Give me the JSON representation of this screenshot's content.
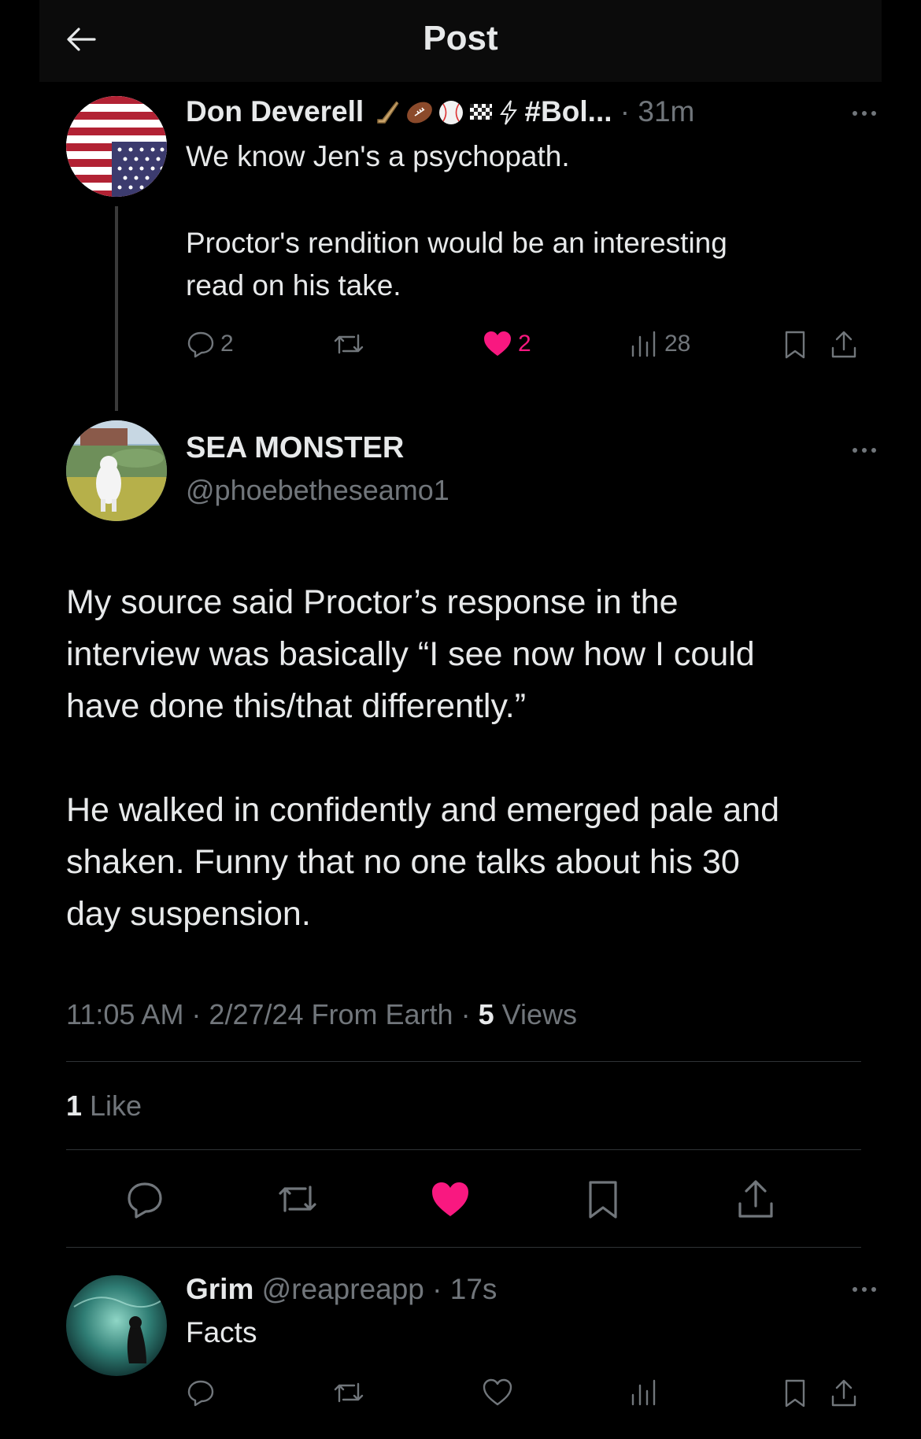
{
  "header": {
    "title": "Post",
    "back_icon": "arrow-left-icon"
  },
  "parent_post": {
    "author": "Don Deverell",
    "badge_emojis": [
      "hockey-stick-icon",
      "football-icon",
      "baseball-icon",
      "checkered-flag-icon",
      "lightning-icon"
    ],
    "hashtag": "#Bol...",
    "time": "· 31m",
    "text_line1": "We know Jen's a psychopath.",
    "text_line2": "Proctor's rendition would be an interesting",
    "text_line3": "read on his take.",
    "replies": "2",
    "reposts": "",
    "likes": "2",
    "views": "28",
    "liked": true
  },
  "main_post": {
    "author": "SEA MONSTER",
    "handle": "@phoebetheseamo1",
    "lines": [
      "My source said Proctor’s response in the",
      "interview was basically “I see now how I could",
      "have done this/that differently.”",
      " He walked in confidently and emerged pale and",
      "shaken. Funny that no one talks about his 30",
      "day suspension."
    ],
    "meta_time": "11:05 AM · 2/27/24 From Earth · ",
    "meta_views_count": "5",
    "meta_views_label": " Views",
    "likes_count": "1",
    "likes_label": " Like",
    "liked": true
  },
  "reply": {
    "author": "Grim",
    "handle": "@reapreapp",
    "time": "· 17s",
    "text": "Facts"
  },
  "colors": {
    "background": "#000000",
    "text": "#e7e9ea",
    "muted": "#71767b",
    "like_pink": "#f91880",
    "divider": "#2f3336"
  }
}
